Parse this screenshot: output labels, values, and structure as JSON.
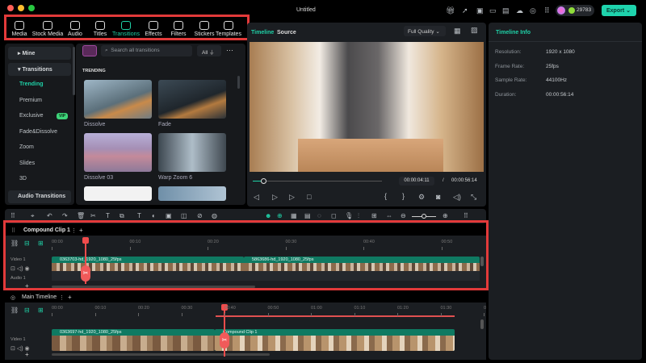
{
  "window": {
    "title": "Untitled"
  },
  "toolbar": {
    "items": [
      {
        "label": "Media",
        "icon": "media-icon"
      },
      {
        "label": "Stock Media",
        "icon": "stock-media-icon"
      },
      {
        "label": "Audio",
        "icon": "audio-icon"
      },
      {
        "label": "Titles",
        "icon": "titles-icon"
      },
      {
        "label": "Transitions",
        "icon": "transitions-icon",
        "active": true
      },
      {
        "label": "Effects",
        "icon": "effects-icon"
      },
      {
        "label": "Filters",
        "icon": "filters-icon"
      },
      {
        "label": "Stickers",
        "icon": "stickers-icon"
      },
      {
        "label": "Templates",
        "icon": "templates-icon"
      }
    ]
  },
  "header": {
    "credits": "29783",
    "export": "Export"
  },
  "sidebar": {
    "mine": "Mine",
    "transitions": "Transitions",
    "items": [
      "Trending",
      "Premium",
      "Exclusive",
      "Fade&Dissolve",
      "Zoom",
      "Slides",
      "3D"
    ],
    "badge": "VIP",
    "audio_transitions": "Audio Transitions"
  },
  "library": {
    "search_placeholder": "Search all transitions",
    "filter": "All",
    "section": "TRENDING",
    "items": [
      "Dissolve",
      "Fade",
      "Dissolve 03",
      "Warp Zoom 6"
    ]
  },
  "preview": {
    "tabs": [
      "Timeline",
      "Source"
    ],
    "quality": "Full Quality",
    "current_time": "00:00:04:11",
    "separator": "/",
    "total_time": "00:00:56:14",
    "progress": 0.08
  },
  "info": {
    "title": "Timeline Info",
    "rows": [
      {
        "label": "Resolution:",
        "value": "1920 x 1080"
      },
      {
        "label": "Frame Rate:",
        "value": "25fps"
      },
      {
        "label": "Sample Rate:",
        "value": "44100Hz"
      },
      {
        "label": "Duration:",
        "value": "00:00:56:14"
      }
    ]
  },
  "compound": {
    "tab": "Compound Clip 1",
    "ticks": [
      "00:00",
      "00:10",
      "00:20",
      "00:30",
      "00:40",
      "00:50"
    ],
    "video_track": "Video 1",
    "audio_track": "Audio 1",
    "clips": [
      "0363703-hd_1920_1080_25fps",
      "5863686-hd_1920_1080_25fps"
    ]
  },
  "main": {
    "tab": "Main Timeline",
    "ticks": [
      "00:00",
      "00:10",
      "00:20",
      "00:30",
      "00:40",
      "00:50",
      "01:00",
      "01:10",
      "01:20",
      "01:30",
      "0"
    ],
    "video_track": "Video 1",
    "clips": [
      "0363697-hd_1920_1080_25fps",
      "Compound Clip 1"
    ]
  }
}
